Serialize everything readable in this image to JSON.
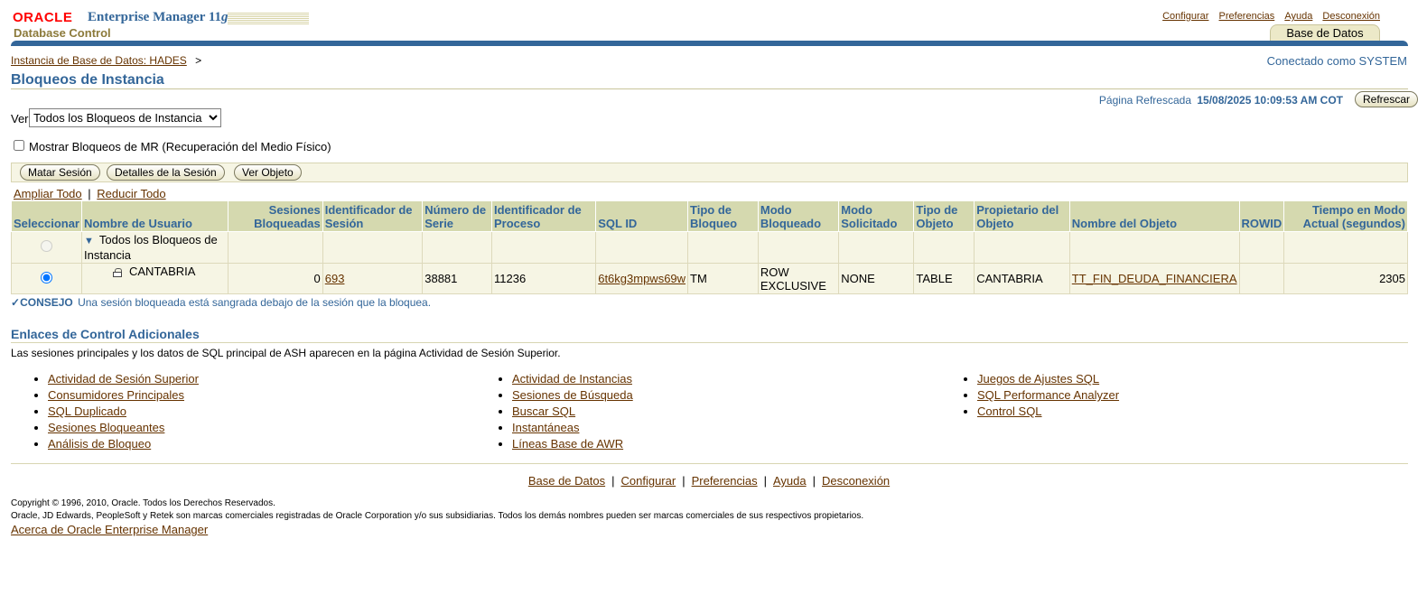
{
  "header": {
    "oracle": "ORACLE",
    "em": "Enterprise Manager 11",
    "em_g": "g",
    "subtitle": "Database Control",
    "global_links": [
      "Configurar",
      "Preferencias",
      "Ayuda",
      "Desconexión"
    ],
    "tab": "Base de Datos"
  },
  "breadcrumb": {
    "link": "Instancia de Base de Datos: HADES",
    "sep": ">"
  },
  "connected": "Conectado como SYSTEM",
  "page_title": "Bloqueos de Instancia",
  "refresh": {
    "label": "Página Refrescada",
    "timestamp": "15/08/2025 10:09:53 AM COT",
    "button": "Refrescar"
  },
  "filter": {
    "label": "Ver",
    "selected": "Todos los Bloqueos de Instancia"
  },
  "mr_checkbox": "Mostrar Bloqueos de MR (Recuperación del Medio Físico)",
  "toolbar": {
    "kill": "Matar Sesión",
    "details": "Detalles de la Sesión",
    "view_object": "Ver Objeto"
  },
  "expand": {
    "expand_all": "Ampliar Todo",
    "sep": "|",
    "collapse_all": "Reducir Todo"
  },
  "table": {
    "headers": {
      "select": "Seleccionar",
      "user": "Nombre de Usuario",
      "blocked": "Sesiones Bloqueadas",
      "session_id": "Identificador de Sesión",
      "serial": "Número de Serie",
      "process": "Identificador de Proceso",
      "sql_id": "SQL ID",
      "lock_type": "Tipo de Bloqueo",
      "mode_held": "Modo Bloqueado",
      "mode_req": "Modo Solicitado",
      "obj_type": "Tipo de Objeto",
      "owner": "Propietario del Objeto",
      "obj_name": "Nombre del Objeto",
      "rowid": "ROWID",
      "time": "Tiempo en Modo Actual (segundos)"
    },
    "root_label": "Todos los Bloqueos de Instancia",
    "row": {
      "user": "CANTABRIA",
      "blocked": "0",
      "session_id": "693",
      "serial": "38881",
      "process": "11236",
      "sql_id": "6t6kg3mpws69w",
      "lock_type": "TM",
      "mode_held": "ROW EXCLUSIVE",
      "mode_req": "NONE",
      "obj_type": "TABLE",
      "owner": "CANTABRIA",
      "obj_name": "TT_FIN_DEUDA_FINANCIERA",
      "rowid": "",
      "time": "2305"
    }
  },
  "tip": {
    "label": "CONSEJO",
    "text": "Una sesión bloqueada está sangrada debajo de la sesión que la bloquea."
  },
  "additional": {
    "title": "Enlaces de Control Adicionales",
    "description": "Las sesiones principales y los datos de SQL principal de ASH aparecen en la página Actividad de Sesión Superior.",
    "col1": [
      "Actividad de Sesión Superior",
      "Consumidores Principales",
      "SQL Duplicado",
      "Sesiones Bloqueantes",
      "Análisis de Bloqueo"
    ],
    "col2": [
      "Actividad de Instancias",
      "Sesiones de Búsqueda",
      "Buscar SQL",
      "Instantáneas",
      "Líneas Base de AWR"
    ],
    "col3": [
      "Juegos de Ajustes SQL",
      "SQL Performance Analyzer",
      "Control SQL"
    ]
  },
  "footer": {
    "links": [
      "Base de Datos",
      "Configurar",
      "Preferencias",
      "Ayuda",
      "Desconexión"
    ],
    "sep": "|",
    "copyright1": "Copyright © 1996, 2010, Oracle. Todos los Derechos Reservados.",
    "copyright2": "Oracle, JD Edwards, PeopleSoft y Retek son marcas comerciales registradas de Oracle Corporation y/o sus subsidiarias. Todos los demás nombres pueden ser marcas comerciales de sus respectivos propietarios.",
    "about": "Acerca de Oracle Enterprise Manager"
  },
  "colors": {
    "accent": "#336699",
    "link": "#663300",
    "header_bg": "#d5d9af",
    "row_bg": "#f6f5e4"
  }
}
